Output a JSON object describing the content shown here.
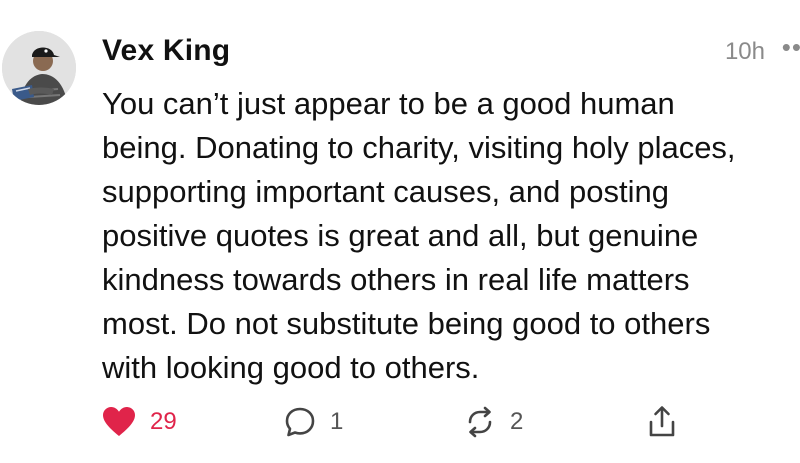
{
  "post": {
    "author": "Vex King",
    "timestamp": "10h",
    "more_label": "••",
    "body_lines": [
      "You can’t just appear to be a good human",
      "being. Donating to charity, visiting holy places,",
      "supporting important causes, and posting",
      "positive quotes is great and all, but genuine",
      "kindness towards others in real life matters",
      "most. Do not substitute being good to others",
      "with looking good to others."
    ],
    "actions": {
      "like": {
        "icon": "heart-icon",
        "count": "29",
        "color": "#e0244a"
      },
      "reply": {
        "icon": "speech-bubble-icon",
        "count": "1"
      },
      "repost": {
        "icon": "repost-arrows-icon",
        "count": "2"
      },
      "share": {
        "icon": "share-upload-icon"
      }
    }
  }
}
